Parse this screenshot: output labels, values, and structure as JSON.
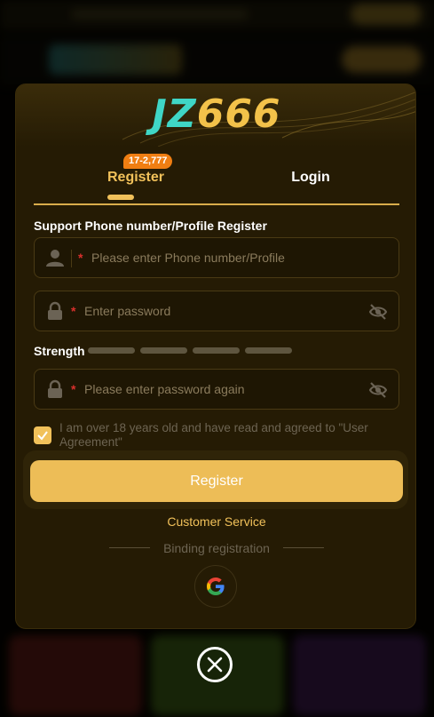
{
  "brand": {
    "logo_part1": "JZ",
    "logo_part2": "666"
  },
  "tabs": {
    "register": {
      "label": "Register",
      "badge": "17-2,777"
    },
    "login": {
      "label": "Login"
    }
  },
  "form": {
    "caption": "Support Phone number/Profile Register",
    "phone": {
      "required_mark": "*",
      "placeholder": "Please enter Phone number/Profile"
    },
    "password": {
      "required_mark": "*",
      "placeholder": "Enter password"
    },
    "strength_label": "Strength",
    "confirm_password": {
      "required_mark": "*",
      "placeholder": "Please enter password again"
    },
    "agreement": {
      "text": "I am over 18 years old and have read and agreed to \"User Agreement\"",
      "checked": true
    },
    "submit_label": "Register"
  },
  "customer_service_label": "Customer Service",
  "binding_label": "Binding registration",
  "colors": {
    "accent": "#f1c15a",
    "modal_bg": "#251b04",
    "badge": "#f07e12",
    "logo_teal": "#3fd6c6"
  },
  "icons": [
    "user-icon",
    "lock-icon",
    "eye-off-icon",
    "check-icon",
    "google-icon",
    "close-icon"
  ]
}
